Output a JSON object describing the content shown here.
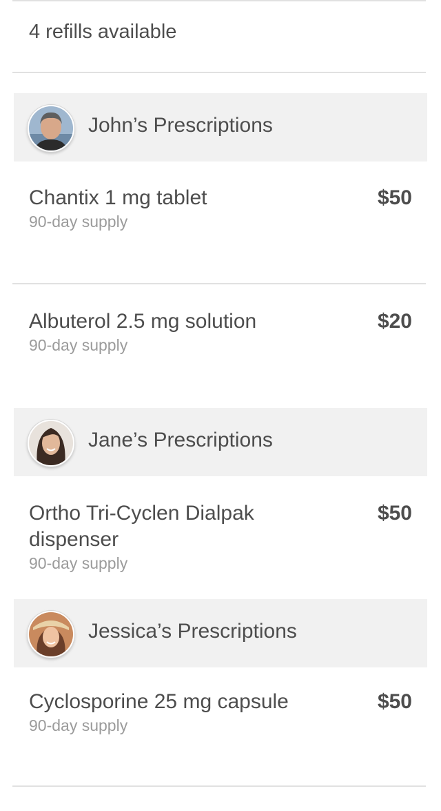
{
  "refills": {
    "label": "4 refills available"
  },
  "sections": [
    {
      "title": "John’s Prescriptions",
      "avatar_icon": "male-avatar-icon",
      "items": [
        {
          "name": "Chantix 1 mg tablet",
          "supply": "90-day supply",
          "price": "$50"
        },
        {
          "name": "Albuterol 2.5 mg solution",
          "supply": "90-day supply",
          "price": "$20"
        }
      ]
    },
    {
      "title": "Jane’s Prescriptions",
      "avatar_icon": "female-avatar-icon",
      "items": [
        {
          "name": "Ortho Tri-Cyclen Dialpak dispenser",
          "supply": "90-day supply",
          "price": "$50"
        }
      ]
    },
    {
      "title": "Jessica’s Prescriptions",
      "avatar_icon": "female-avatar-icon",
      "items": [
        {
          "name": "Cyclosporine 25 mg capsule",
          "supply": "90-day supply",
          "price": "$50"
        }
      ]
    }
  ],
  "colors": {
    "header_bg": "#f1f1f1",
    "text": "#4d4d4d",
    "muted_text": "#9b9b9b",
    "divider": "#e1e1e1"
  }
}
